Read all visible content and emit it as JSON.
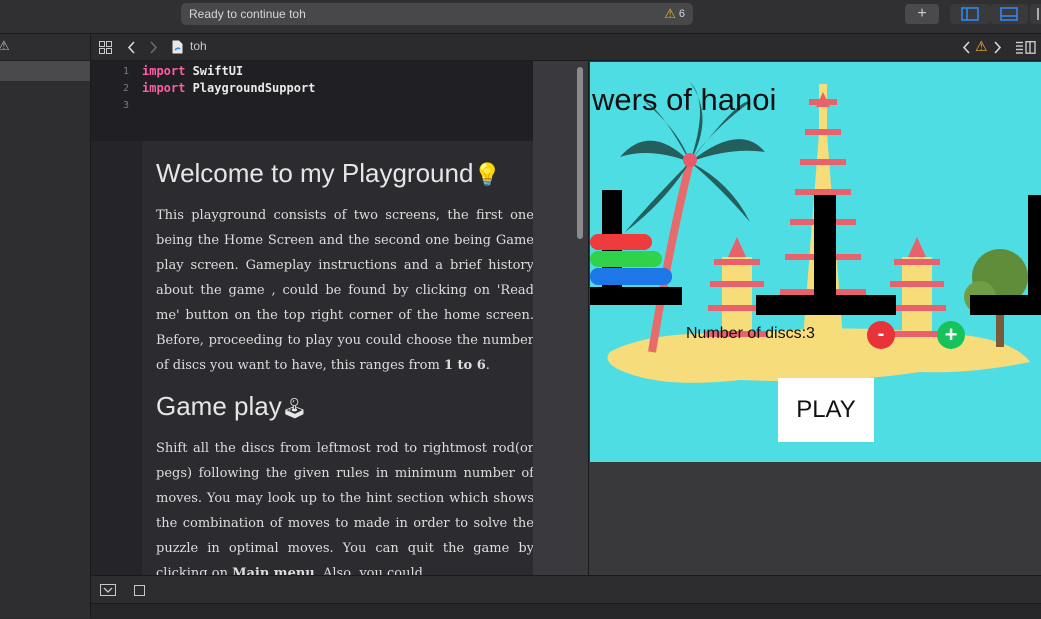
{
  "toolbar": {
    "status_text": "Ready to continue toh",
    "warning_count": "6",
    "add_label": "+"
  },
  "jumpbar": {
    "file_name": "toh"
  },
  "editor": {
    "line_numbers": [
      "1",
      "2",
      "3"
    ],
    "lines": [
      {
        "keyword": "import",
        "rest": " SwiftUI"
      },
      {
        "keyword": "import",
        "rest": " PlaygroundSupport"
      }
    ]
  },
  "doc": {
    "heading1": "Welcome to my Playground",
    "heading1_emoji": "💡",
    "para1_a": "This playground consists of two screens, the first one being the Home Screen and the second one being Game play screen. Gameplay instructions and a brief history about the game , could be found by clicking on 'Read me' button on the top right corner of the home screen. Before, proceeding to play you could choose the number of discs you want to have, this ranges from ",
    "para1_bold": "1 to 6",
    "para1_end": ".",
    "heading2": "Game play",
    "heading2_emoji": "🕹",
    "para2_a": "Shift all the discs from leftmost rod to rightmost rod(or pegs) following the given rules in minimum number of moves. You may look up to the hint section which shows the combination of moves to made in order to solve the puzzle in optimal moves. You can quit the game by clicking on ",
    "para2_bold": "Main menu",
    "para2_end": ". Also, you could"
  },
  "live": {
    "title": "wers of hanoi",
    "discs_label": "Number of discs:3",
    "minus_label": "-",
    "plus_label": "+",
    "play_label": "PLAY"
  },
  "colors": {
    "scene_bg": "#4fdde4",
    "disc_red": "#ef3b3b",
    "disc_green": "#2fd24a",
    "disc_blue": "#1d77e8",
    "minus_button": "#e8333a",
    "plus_button": "#16c35a",
    "keyword": "#fc5fa3"
  },
  "icons": [
    "warning-icon",
    "grid-icon",
    "back-chevron-icon",
    "forward-chevron-icon",
    "swift-file-icon",
    "inspector-icon",
    "console-toggle-icon",
    "stop-icon"
  ]
}
